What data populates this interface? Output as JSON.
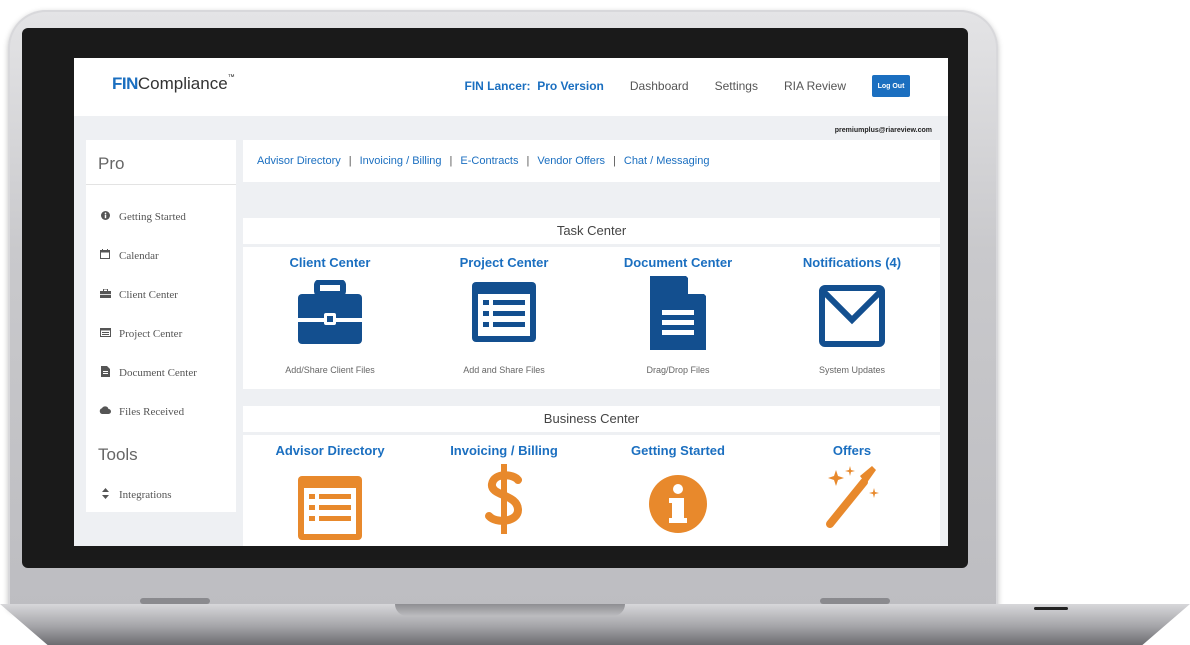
{
  "header": {
    "logo_fin": "FIN",
    "logo_rest": "Compliance",
    "logo_tm": "™",
    "brand_link": "FIN Lancer:  Pro Version",
    "nav": [
      "Dashboard",
      "Settings",
      "RIA Review"
    ],
    "logout_label": "Log Out",
    "user_email": "premiumplus@riareview.com"
  },
  "sidebar": {
    "heading_pro": "Pro",
    "items": [
      {
        "label": "Getting Started",
        "icon": "info-circle-icon"
      },
      {
        "label": "Calendar",
        "icon": "calendar-icon"
      },
      {
        "label": "Client Center",
        "icon": "briefcase-icon"
      },
      {
        "label": "Project Center",
        "icon": "list-icon"
      },
      {
        "label": "Document Center",
        "icon": "document-icon"
      },
      {
        "label": "Files Received",
        "icon": "cloud-icon"
      }
    ],
    "heading_tools": "Tools",
    "tools": [
      {
        "label": "Integrations",
        "icon": "sort-icon"
      }
    ]
  },
  "quicklinks": [
    "Advisor Directory",
    "Invoicing / Billing",
    "E-Contracts",
    "Vendor Offers",
    "Chat / Messaging"
  ],
  "task_center": {
    "title": "Task Center",
    "cards": [
      {
        "title": "Client Center",
        "caption": "Add/Share Client Files",
        "icon": "briefcase-icon"
      },
      {
        "title": "Project Center",
        "caption": "Add and Share Files",
        "icon": "list-icon"
      },
      {
        "title": "Document Center",
        "caption": "Drag/Drop Files",
        "icon": "document-icon"
      },
      {
        "title": "Notifications (4)",
        "caption": "System Updates",
        "icon": "envelope-icon"
      }
    ]
  },
  "business_center": {
    "title": "Business Center",
    "cards": [
      {
        "title": "Advisor Directory",
        "icon": "list-icon"
      },
      {
        "title": "Invoicing / Billing",
        "icon": "dollar-icon"
      },
      {
        "title": "Getting Started",
        "icon": "info-circle-icon"
      },
      {
        "title": "Offers",
        "icon": "magic-wand-icon"
      }
    ]
  },
  "colors": {
    "accent_blue": "#1b6fc0",
    "icon_blue": "#134f8f",
    "icon_orange": "#e8892c"
  }
}
